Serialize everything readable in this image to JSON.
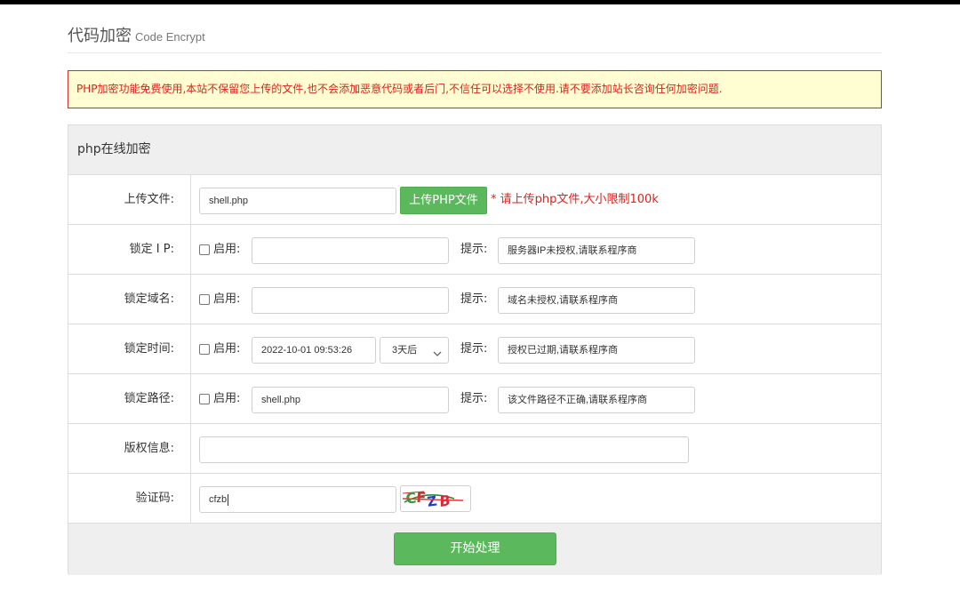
{
  "header": {
    "title": "代码加密",
    "subtitle": "Code Encrypt"
  },
  "alert": {
    "text": "PHP加密功能免费使用,本站不保留您上传的文件,也不会添加恶意代码或者后门,不信任可以选择不使用.请不要添加站长咨询任何加密问题."
  },
  "panel": {
    "title": "php在线加密"
  },
  "form": {
    "upload": {
      "label": "上传文件:",
      "value": "shell.php",
      "button": "上传PHP文件",
      "note": "* 请上传php文件,大小限制100k"
    },
    "lock_ip": {
      "label": "锁定 I P:",
      "enable": "启用:",
      "value": "",
      "hint_label": "提示:",
      "hint_value": "服务器IP未授权,请联系程序商"
    },
    "lock_domain": {
      "label": "锁定域名:",
      "enable": "启用:",
      "value": "",
      "hint_label": "提示:",
      "hint_value": "域名未授权,请联系程序商"
    },
    "lock_time": {
      "label": "锁定时间:",
      "enable": "启用:",
      "value": "2022-10-01 09:53:26",
      "select": "3天后",
      "hint_label": "提示:",
      "hint_value": "授权已过期,请联系程序商"
    },
    "lock_path": {
      "label": "锁定路径:",
      "enable": "启用:",
      "value": "shell.php",
      "hint_label": "提示:",
      "hint_value": "该文件路径不正确,请联系程序商"
    },
    "copyright": {
      "label": "版权信息:",
      "value": ""
    },
    "captcha": {
      "label": "验证码:",
      "value": "cfzb",
      "image_text": "CFZB"
    }
  },
  "submit": {
    "label": "开始处理"
  },
  "colors": {
    "primary_green": "#5cb85c",
    "alert_red": "#d9241c",
    "alert_bg": "#fffdd1"
  }
}
